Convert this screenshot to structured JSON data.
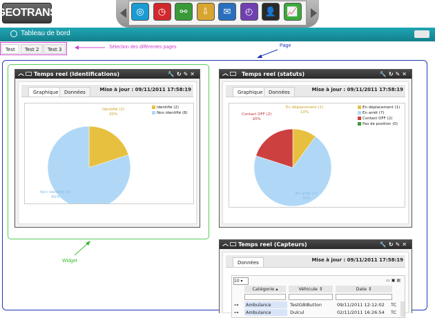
{
  "app": {
    "logo": "GEOTRANS"
  },
  "header": {
    "icons": [
      {
        "name": "dashboard-gauge-icon",
        "color": "#1a9bd1"
      },
      {
        "name": "history-clock-icon",
        "color": "#d0282d"
      },
      {
        "name": "network-nodes-icon",
        "color": "#3a9a3a"
      },
      {
        "name": "download-arrow-icon",
        "color": "#d8a531"
      },
      {
        "name": "mail-envelope-icon",
        "color": "#2a6fbf"
      },
      {
        "name": "time-clock-icon",
        "color": "#7040b0"
      },
      {
        "name": "user-profile-icon",
        "color": "#2a2a2a"
      },
      {
        "name": "stats-chart-icon",
        "color": "#3aaa3a"
      }
    ]
  },
  "titlebar": {
    "title": "Tableau de bord",
    "accent": "#1a94a3"
  },
  "page_tabs": [
    "Test",
    "Test 2",
    "Test 3"
  ],
  "annotations": {
    "tabs_note": "Sélection des différentes pages",
    "page_note": "Page",
    "widget_note": "Widget"
  },
  "widgets": {
    "identifications": {
      "title": "Temps reel (Identifications)",
      "tabs": [
        "Graphique",
        "Données"
      ],
      "update": "Mise à jour : 09/11/2011 17:58:19",
      "chart_data": {
        "type": "pie",
        "slices": [
          {
            "label": "Identifié (2)",
            "value": 20,
            "color": "#e8c040",
            "callout": "Identifié (2)",
            "pct": "20%"
          },
          {
            "label": "Non identifié (8)",
            "value": 80,
            "color": "#b0d8f6",
            "callout": "Non identifié (8)",
            "pct": "80%"
          }
        ]
      }
    },
    "statuts": {
      "title": "Temps reel (statuts)",
      "tabs": [
        "Graphique",
        "Données"
      ],
      "update": "Mise à jour : 09/11/2011 17:58:19",
      "chart_data": {
        "type": "pie",
        "slices": [
          {
            "label": "En déplacement (1)",
            "value": 10,
            "color": "#e8c040",
            "callout": "En déplacement (1)",
            "pct": "10%"
          },
          {
            "label": "En arrêt (7)",
            "value": 70,
            "color": "#b0d8f6",
            "callout": "En arrêt (7)",
            "pct": "70%"
          },
          {
            "label": "Contact OFF (2)",
            "value": 20,
            "color": "#cc4040",
            "callout": "Contact OFF (2)",
            "pct": "20%"
          },
          {
            "label": "Pas de position (0)",
            "value": 0,
            "color": "#3a9a3a"
          }
        ]
      }
    },
    "capteurs": {
      "title": "Temps reel (Capteurs)",
      "tabs": [
        "Données"
      ],
      "update": "Mise à jour : 09/11/2011 17:58:19",
      "page_size": "10",
      "columns": [
        "Catégorie",
        "Véhicule",
        "Date"
      ],
      "rows": [
        {
          "categorie": "Ambulance",
          "vehicule": "TestGBIButton",
          "date": "09/11/2011 12:12:02",
          "extra": "TC"
        },
        {
          "categorie": "Ambulance",
          "vehicule": "Dulcul",
          "date": "02/11/2011 16:26:54",
          "extra": "TC"
        }
      ]
    }
  }
}
